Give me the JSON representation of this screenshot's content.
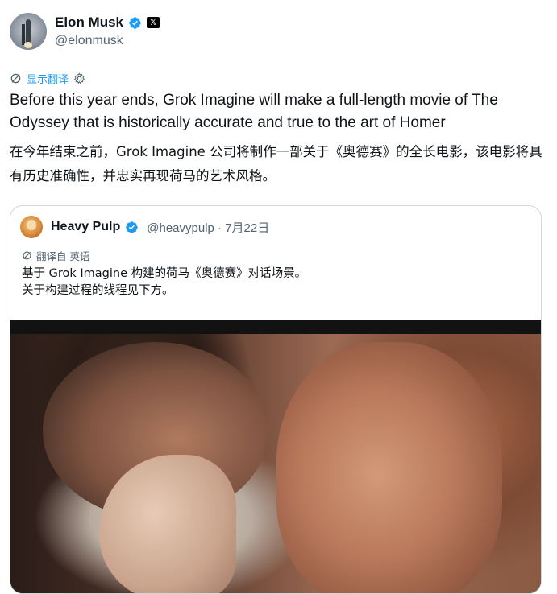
{
  "author": {
    "name": "Elon Musk",
    "handle": "@elonmusk",
    "avatar_icon": "rocket-avatar",
    "verified_color": "#1d9bf0"
  },
  "translate": {
    "show_translation_label": "显示翻译"
  },
  "tweet": {
    "text_en": "Before this year ends, Grok Imagine will make a full-length movie of The Odyssey that is historically accurate and true to the art of Homer",
    "text_zh": "在今年结束之前，Grok Imagine 公司将制作一部关于《奥德赛》的全长电影，该电影将具有历史准确性，并忠实再现荷马的艺术风格。"
  },
  "quoted": {
    "name": "Heavy Pulp",
    "handle_date": "@heavypulp · 7月22日",
    "translated_from_label": "翻译自 英语",
    "line1": "基于 Grok Imagine 构建的荷马《奥德赛》对话场景。",
    "line2": "关于构建过程的线程见下方。",
    "media_icon": "movie-still-image"
  },
  "colors": {
    "accent": "#1d9bf0",
    "text": "#0f1419",
    "muted": "#536471",
    "border": "#cfd9de"
  }
}
